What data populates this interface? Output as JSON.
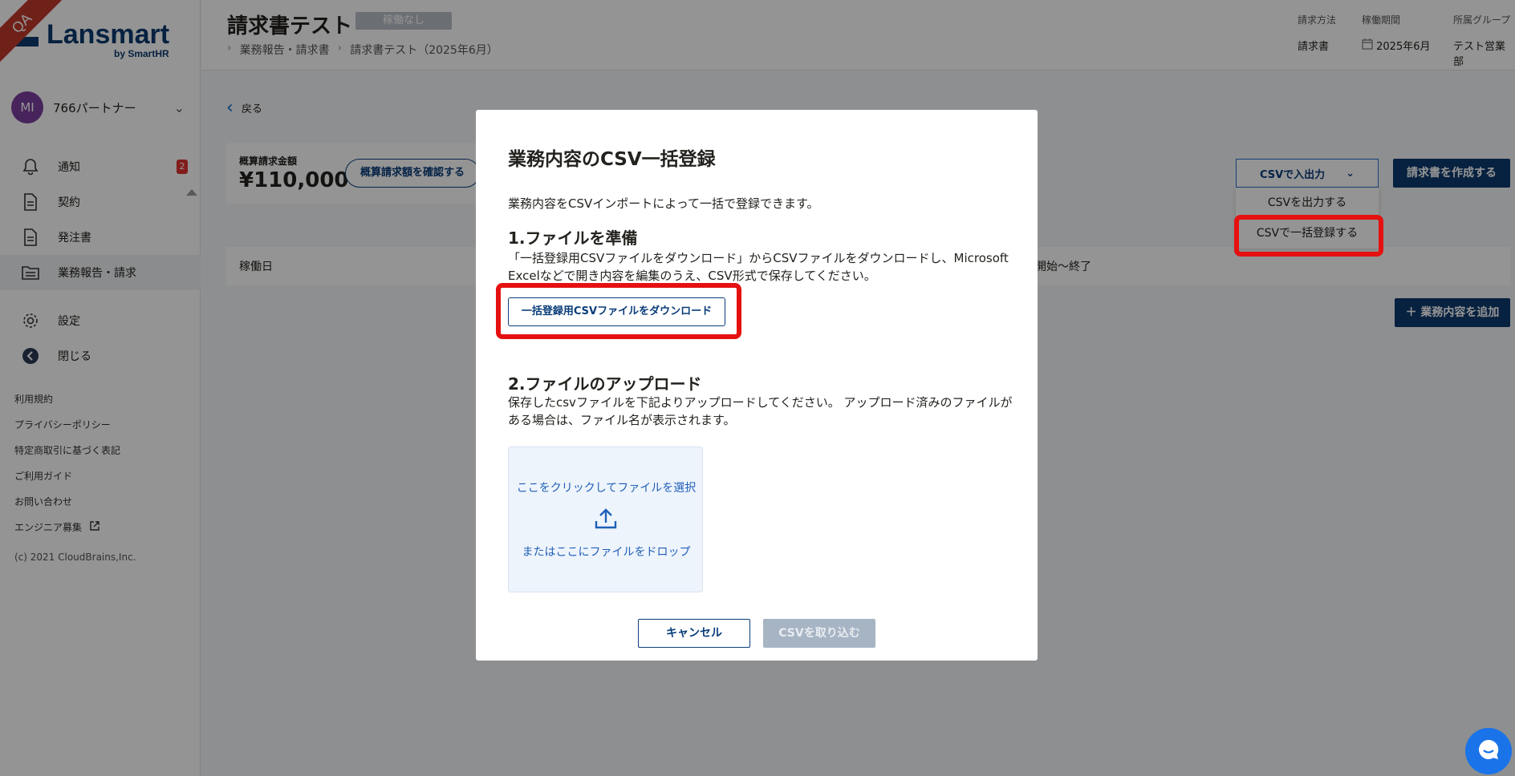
{
  "ribbon": "QA",
  "brand": {
    "name": "Lansmart",
    "sub": "by SmartHR"
  },
  "account": {
    "initials": "MI",
    "name": "766パートナー"
  },
  "nav": [
    {
      "label": "通知",
      "icon": "bell-icon",
      "badge": "2"
    },
    {
      "label": "契約",
      "icon": "document-icon"
    },
    {
      "label": "発注書",
      "icon": "document-icon"
    },
    {
      "label": "業務報告・請求",
      "icon": "folder-icon",
      "active": true
    },
    {
      "label": "設定",
      "icon": "gear-icon"
    },
    {
      "label": "閉じる",
      "icon": "arrow-left-circle-icon"
    }
  ],
  "footer_links": [
    "利用規約",
    "プライバシーポリシー",
    "特定商取引に基づく表記",
    "ご利用ガイド",
    "お問い合わせ",
    "エンジニア募集"
  ],
  "copyright": "(c) 2021 CloudBrains,Inc.",
  "header": {
    "title": "請求書テスト",
    "status": "稼働なし",
    "breadcrumb": [
      "業務報告・請求書",
      "請求書テスト（2025年6月）"
    ],
    "meta": [
      {
        "label": "請求方法",
        "value": "請求書"
      },
      {
        "label": "稼働期間",
        "value": "2025年6月"
      },
      {
        "label": "所属グループ",
        "value": "テスト営業部"
      }
    ]
  },
  "main": {
    "back": "戻る",
    "summary_label": "概算請求金額",
    "summary_value": "¥110,000",
    "summary_button": "概算請求額を確認する",
    "csv_select": "CSVで入出力",
    "create_button": "請求書を作成する",
    "dropdown": [
      "CSVを出力する",
      "CSVで一括登録する"
    ],
    "table_col1": "稼働日",
    "table_col2": "開始～終了",
    "add_button": "＋ 業務内容を追加"
  },
  "modal": {
    "title": "業務内容のCSV一括登録",
    "intro": "業務内容をCSVインポートによって一括で登録できます。",
    "step1_title": "1.ファイルを準備",
    "step1_desc": "「一括登録用CSVファイルをダウンロード」からCSVファイルをダウンロードし、Microsoft Excelなどで開き内容を編集のうえ、CSV形式で保存してください。",
    "download_button": "一括登録用CSVファイルをダウンロード",
    "step2_title": "2.ファイルのアップロード",
    "step2_desc": "保存したcsvファイルを下記よりアップロードしてください。 アップロード済みのファイルがある場合は、ファイル名が表示されます。",
    "dropzone_click": "ここをクリックしてファイルを選択",
    "dropzone_drop": "またはここにファイルをドロップ",
    "cancel_button": "キャンセル",
    "import_button": "CSVを取り込む"
  },
  "colors": {
    "brand": "#0d3a6e",
    "highlight": "#e51111",
    "link": "#1f5fb8"
  }
}
